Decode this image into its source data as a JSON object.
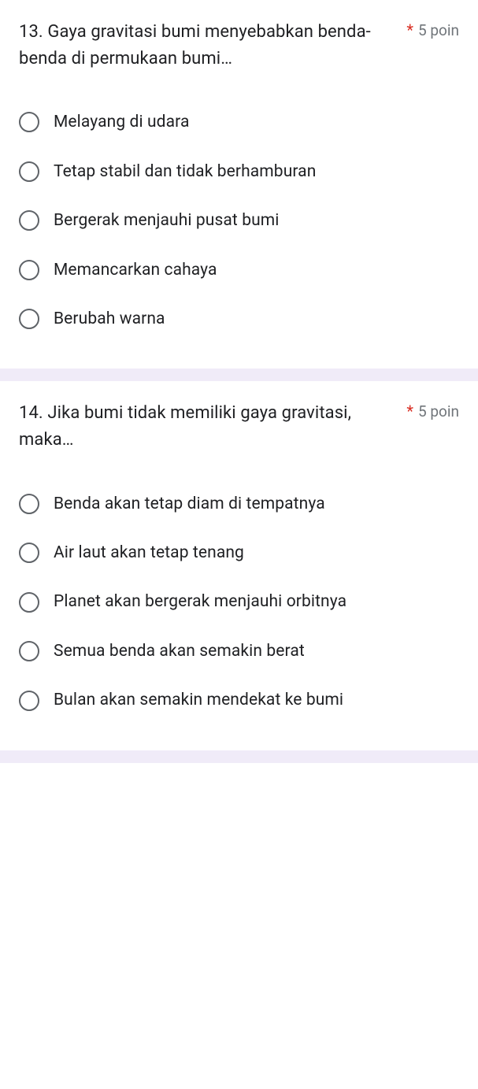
{
  "questions": [
    {
      "text": "13. Gaya gravitasi bumi menyebabkan benda-benda di permukaan bumi…",
      "required": "*",
      "points": "5 poin",
      "options": [
        "Melayang di udara",
        "Tetap stabil dan tidak berhamburan",
        "Bergerak menjauhi pusat bumi",
        "Memancarkan cahaya",
        "Berubah warna"
      ]
    },
    {
      "text": "14. Jika bumi tidak memiliki gaya gravitasi, maka…",
      "required": "*",
      "points": "5 poin",
      "options": [
        "Benda akan tetap diam di tempatnya",
        "Air laut akan tetap tenang",
        "Planet akan bergerak menjauhi orbitnya",
        "Semua benda akan semakin berat",
        "Bulan akan semakin mendekat ke bumi"
      ]
    }
  ]
}
